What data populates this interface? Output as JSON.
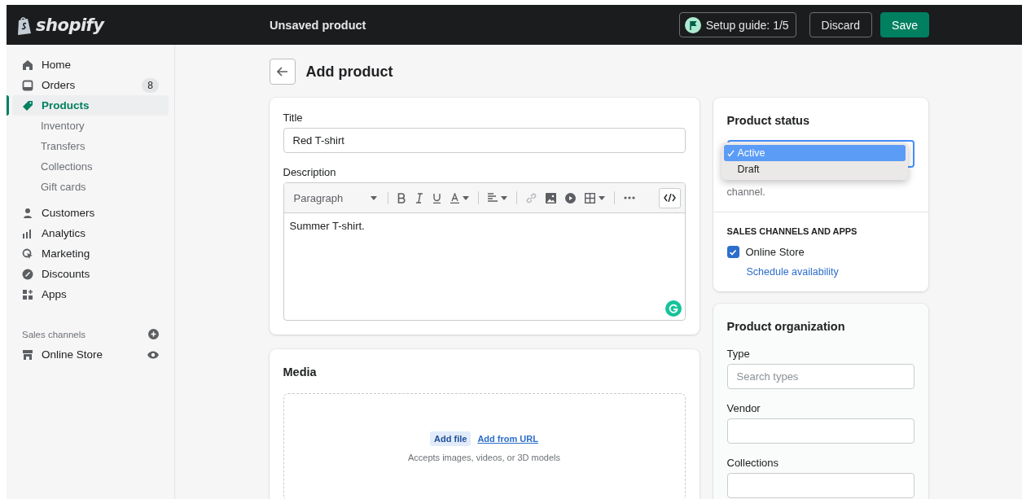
{
  "topbar": {
    "logo": "shopify",
    "title": "Unsaved product",
    "setup_guide": "Setup guide: 1/5",
    "buttons": [
      {
        "label": "Discard",
        "kind": "secondary"
      },
      {
        "label": "Save",
        "kind": "primary"
      }
    ]
  },
  "sidebar": {
    "items": [
      {
        "label": "Home",
        "selected": false
      },
      {
        "label": "Orders",
        "badge": "8",
        "selected": false
      },
      {
        "label": "Products",
        "selected": true,
        "children": [
          {
            "label": "Inventory",
            "selected": false
          },
          {
            "label": "Transfers",
            "selected": false
          },
          {
            "label": "Collections",
            "selected": false
          },
          {
            "label": "Gift cards",
            "selected": false
          }
        ]
      },
      {
        "label": "Customers",
        "selected": false
      },
      {
        "label": "Analytics",
        "selected": false
      },
      {
        "label": "Marketing",
        "selected": false
      },
      {
        "label": "Discounts",
        "selected": false
      },
      {
        "label": "Apps",
        "selected": false
      }
    ],
    "sales_channels": {
      "heading": "Sales channels",
      "items": [
        {
          "label": "Online Store",
          "selected": false
        }
      ]
    }
  },
  "page": {
    "title": "Add product"
  },
  "product": {
    "title_label": "Title",
    "title_value": "Red T-shirt",
    "description_label": "Description",
    "format": "Paragraph",
    "description": "Summer T-shirt."
  },
  "media": {
    "title": "Media",
    "add_file": "Add file",
    "add_url": "Add from URL",
    "hint": "Accepts images, videos, or 3D models"
  },
  "status": {
    "title": "Product status",
    "options": [
      {
        "label": "Active",
        "selected": true
      },
      {
        "label": "Draft",
        "selected": false
      }
    ],
    "hint": "channel.",
    "channels_heading": "SALES CHANNELS AND APPS",
    "channels": [
      {
        "label": "Online Store",
        "checked": true
      }
    ],
    "schedule_link": "Schedule availability"
  },
  "organization": {
    "title": "Product organization",
    "fields": [
      {
        "label": "Type",
        "placeholder": "Search types"
      },
      {
        "label": "Vendor"
      },
      {
        "label": "Collections"
      }
    ]
  }
}
